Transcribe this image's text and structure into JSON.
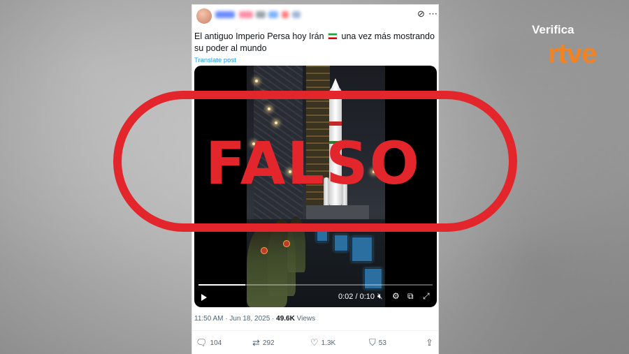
{
  "tweet": {
    "text_before_flag": "El antiguo Imperio Persa hoy Irán",
    "text_after_flag": "una vez más mostrando su poder al mundo",
    "translate_label": "Translate post",
    "flag_icon": "iran-flag-icon",
    "header_icons": [
      "grok-icon",
      "more-icon"
    ]
  },
  "video": {
    "time_display": "0:02 / 0:10",
    "progress_fraction": 0.2,
    "controls": [
      "play-icon",
      "volume-muted-icon",
      "settings-icon",
      "pip-icon",
      "fullscreen-icon"
    ]
  },
  "meta": {
    "time": "11:50 AM",
    "separator": "·",
    "date": "Jun 18, 2025",
    "views_count": "49.6K",
    "views_label": "Views"
  },
  "actions": {
    "replies": "104",
    "reposts": "292",
    "likes": "1.3K",
    "bookmarks": "53"
  },
  "overlay": {
    "label": "FALSO",
    "color": "#e3262b"
  },
  "brand": {
    "line1": "Verifica",
    "line2": "rtve",
    "accent": "#f58220"
  }
}
